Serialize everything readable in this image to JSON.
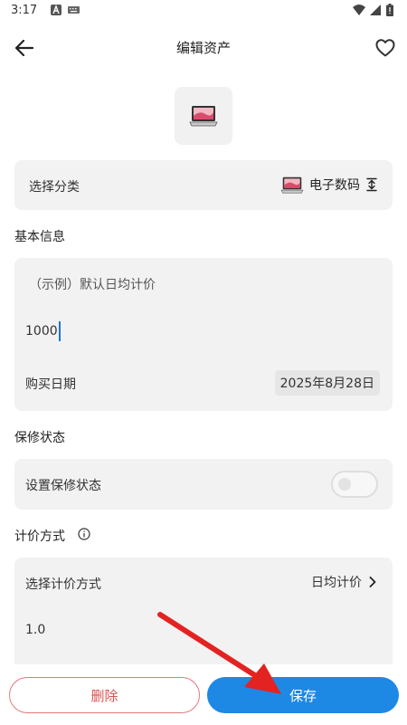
{
  "status_bar": {
    "time": "3:17"
  },
  "app_bar": {
    "title": "编辑资产"
  },
  "category": {
    "label": "选择分类",
    "value": "电子数码"
  },
  "basic_info": {
    "section_title": "基本信息",
    "price_name": "（示例）默认日均计价",
    "price_value": "1000",
    "purchase_date_label": "购买日期",
    "purchase_date_value": "2025年8月28日"
  },
  "warranty": {
    "section_title": "保修状态",
    "label": "设置保修状态",
    "enabled": false
  },
  "pricing": {
    "section_title": "计价方式",
    "label": "选择计价方式",
    "value": "日均计价",
    "number": "1.0"
  },
  "actions": {
    "delete_label": "删除",
    "save_label": "保存"
  },
  "colors": {
    "accent": "#1e88e5",
    "danger": "#e05050",
    "card_bg": "#f2f2f2",
    "annotation_arrow": "#e32222"
  }
}
